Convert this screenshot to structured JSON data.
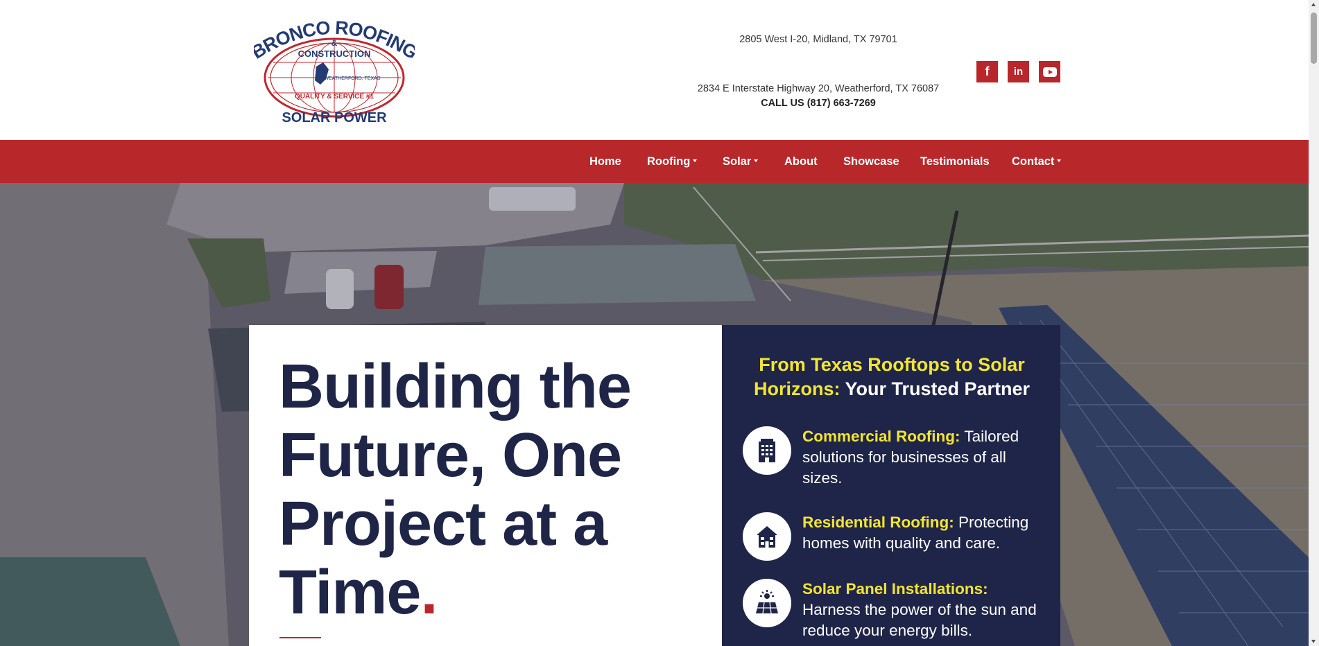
{
  "header": {
    "logo": {
      "line1": "BRONCO ROOFING",
      "amp": "&",
      "line2": "CONSTRUCTION",
      "location": "WEATHERFORD, TEXAS",
      "quality": "QUALITY & SERVICE #1",
      "line3": "SOLAR POWER"
    },
    "address_1": "2805 West I-20, Midland, TX 79701",
    "address_2": "2834 E Interstate Highway 20, Weatherford, TX 76087",
    "call": "CALL US (817) 663-7269",
    "social": [
      {
        "icon": "facebook-icon",
        "glyph": "f"
      },
      {
        "icon": "linkedin-icon",
        "glyph": "in"
      },
      {
        "icon": "youtube-icon",
        "glyph": "play"
      }
    ]
  },
  "nav": {
    "items": [
      {
        "label": "Home",
        "dropdown": false
      },
      {
        "label": "Roofing",
        "dropdown": true
      },
      {
        "label": "Solar",
        "dropdown": true
      },
      {
        "label": "About",
        "dropdown": false
      },
      {
        "label": "Showcase",
        "dropdown": false
      },
      {
        "label": "Testimonials",
        "dropdown": false
      },
      {
        "label": "Contact",
        "dropdown": true
      }
    ]
  },
  "hero": {
    "headline_1": "Building the",
    "headline_2": "Future, One",
    "headline_3": "Project at a",
    "headline_4": "Time",
    "headline_dot": ".",
    "tagline_highlight": "From Texas Rooftops to Solar Horizons:",
    "tagline_rest": " Your Trusted Partner",
    "features": [
      {
        "icon": "office-building-icon",
        "title": "Commercial Roofing:",
        "text": " Tailored solutions for businesses of all sizes."
      },
      {
        "icon": "house-icon",
        "title": "Residential Roofing:",
        "text": " Protecting homes with quality and care."
      },
      {
        "icon": "solar-panel-icon",
        "title": "Solar Panel Installations:",
        "text": " Harness the power of the sun and reduce your energy bills."
      }
    ]
  },
  "colors": {
    "brand_red": "#b8282b",
    "navy": "#1f2548",
    "headline_navy": "#1e2546",
    "highlight_yellow": "#f4e531"
  }
}
